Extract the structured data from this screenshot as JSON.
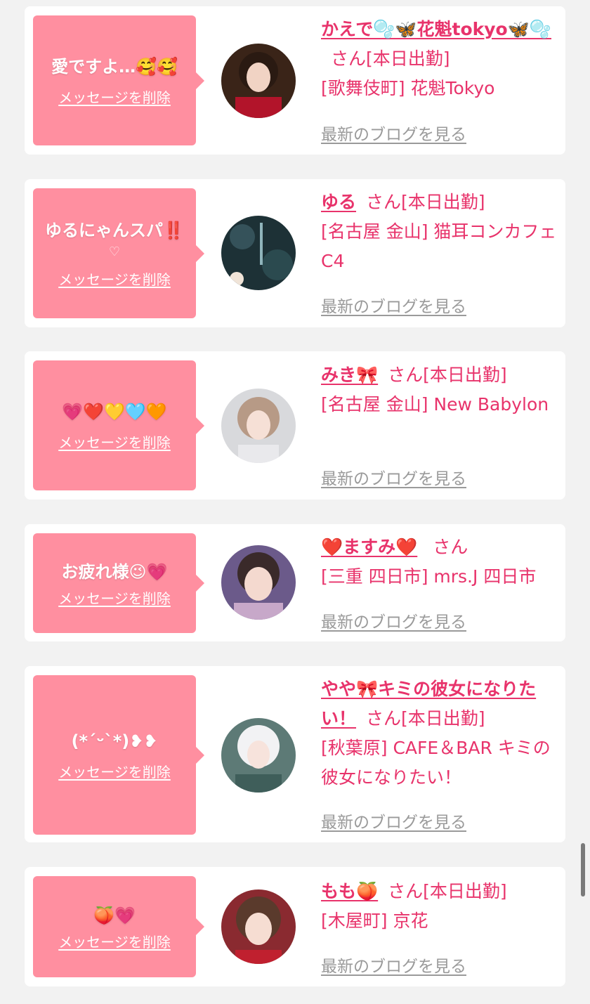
{
  "delete_label": "メッセージを削除",
  "blog_label": "最新のブログを見る",
  "san_label": "さん",
  "cards": [
    {
      "message": "愛ですよ…🥰🥰",
      "message_sub": "",
      "name": "かえで🫧🦋花魁tokyo🦋🫧",
      "status": "[本日出勤]",
      "shop": "[歌舞伎町] 花魁Tokyo"
    },
    {
      "message": "ゆるにゃんスパ‼️",
      "message_sub": "♡",
      "name": "ゆる",
      "status": "[本日出勤]",
      "shop": "[名古屋 金山] 猫耳コンカフェ C4"
    },
    {
      "message": "💗❤️💛🩵🧡",
      "message_sub": "",
      "name": "みき🎀",
      "status": "[本日出勤]",
      "shop": "[名古屋 金山] New Babylon"
    },
    {
      "message": "お疲れ様😉💗",
      "message_sub": "",
      "name": "❤️ますみ❤️",
      "status": "",
      "shop": "[三重 四日市] mrs.J 四日市"
    },
    {
      "message": "(*ˊᵕˋ*)❥❥",
      "message_sub": "",
      "name": "やや🎀キミの彼女になりたい！",
      "status": "[本日出勤]",
      "shop": "[秋葉原] CAFE＆BAR キミの彼女になりたい！"
    },
    {
      "message": "🍑💗",
      "message_sub": "",
      "name": "もも🍑",
      "status": "[本日出勤]",
      "shop": "[木屋町] 京花"
    }
  ],
  "colors": {
    "accent": "#e8336b",
    "bubble": "#ff8fa0",
    "background": "#f2f2f2"
  }
}
